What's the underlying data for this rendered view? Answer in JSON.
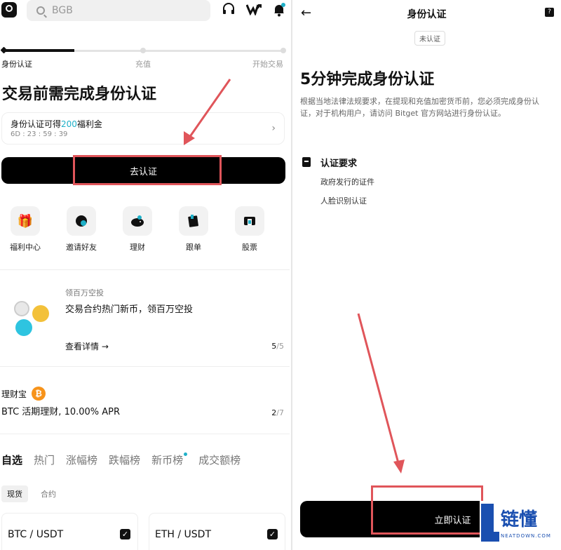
{
  "left": {
    "search": {
      "placeholder": "BGB"
    },
    "steps": [
      "身份认证",
      "充值",
      "开始交易"
    ],
    "title": "交易前需完成身份认证",
    "bonus": {
      "prefix": "身份认证可得",
      "amount": "200",
      "suffix": "福利金",
      "countdown": "6D : 23 : 59 : 39"
    },
    "go_button": "去认证",
    "quick": [
      {
        "icon": "gift-icon",
        "label": "福利中心"
      },
      {
        "icon": "invite-icon",
        "label": "邀请好友"
      },
      {
        "icon": "piggy-bank-icon",
        "label": "理财"
      },
      {
        "icon": "copy-trade-icon",
        "label": "跟单"
      },
      {
        "icon": "stock-icon",
        "label": "股票"
      }
    ],
    "promo": {
      "subtitle": "领百万空投",
      "title": "交易合约热门新币，领百万空投",
      "link": "查看详情",
      "page": "5",
      "total": "/5"
    },
    "earn": {
      "label": "理财宝",
      "badge": "₿",
      "title": "BTC 活期理财, 10.00% APR",
      "page": "2",
      "total": "/7"
    },
    "tabs": [
      "自选",
      "热门",
      "涨幅榜",
      "跌幅榜",
      "新币榜",
      "成交额榜"
    ],
    "subtabs": [
      "现货",
      "合约"
    ],
    "pairs": [
      "BTC / USDT",
      "ETH / USDT"
    ]
  },
  "right": {
    "header": "身份认证",
    "badge": "未认证",
    "title": "5分钟完成身份认证",
    "desc": "根据当地法律法规要求，在提现和充值加密货币前，您必须完成身份认证，对于机构用户，请访问 Bitget 官方网站进行身份认证。",
    "req_title": "认证要求",
    "req_items": [
      "政府发行的证件",
      "人脸识别认证"
    ],
    "button": "立即认证"
  },
  "watermark": {
    "text": "链懂",
    "sub": "NEATDOWN.COM"
  },
  "colors": {
    "accent": "#1fb0c8",
    "annotation": "#e0555a",
    "brand": "#1a4fb0"
  }
}
